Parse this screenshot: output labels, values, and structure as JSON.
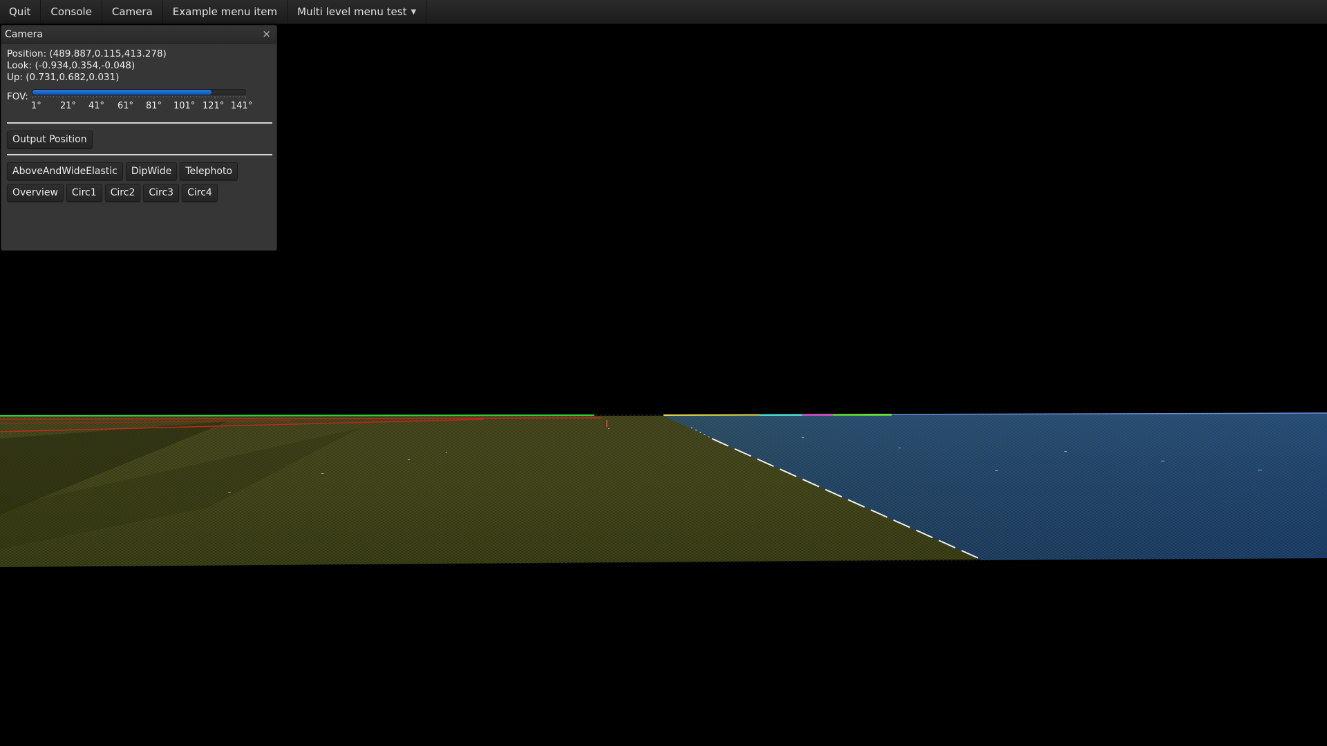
{
  "menubar": {
    "items": [
      {
        "label": "Quit"
      },
      {
        "label": "Console"
      },
      {
        "label": "Camera"
      },
      {
        "label": "Example menu item"
      },
      {
        "label": "Multi level menu test",
        "has_submenu": true
      }
    ]
  },
  "camera_window": {
    "title": "Camera",
    "close_label": "×",
    "position_text": "Position: (489.887,0.115,413.278)",
    "look_text": "Look: (-0.934,0.354,-0.048)",
    "up_text": "Up: (0.731,0.682,0.031)",
    "fov": {
      "label": "FOV:",
      "fraction": 0.84,
      "tick_labels": [
        "1°",
        "21°",
        "41°",
        "61°",
        "81°",
        "101°",
        "121°",
        "141°"
      ]
    },
    "output_position_label": "Output Position",
    "preset_row_1": [
      "AboveAndWideElastic",
      "DipWide",
      "Telephoto"
    ],
    "preset_row_2": [
      "Overview",
      "Circ1",
      "Circ2",
      "Circ3",
      "Circ4"
    ]
  },
  "colors": {
    "ground": "#3a3d14",
    "water": "#123a70",
    "slider": "#1a66d0",
    "horizon_green": "#3ad23a",
    "horizon_red": "#c0281c"
  }
}
